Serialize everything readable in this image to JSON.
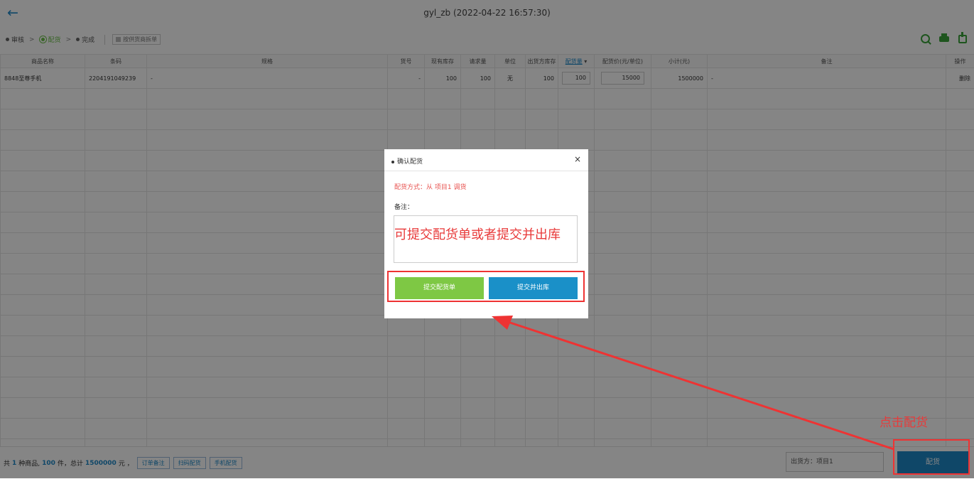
{
  "header": {
    "back_icon": "back-arrow-icon",
    "title": "gyl_zb  (2022-04-22 16:57:30)"
  },
  "steps": [
    {
      "label": "审核",
      "active": false
    },
    {
      "label": "配货",
      "active": true
    },
    {
      "label": "完成",
      "active": false
    }
  ],
  "split_by_supplier_label": "按供货商拆单",
  "tool_icons": [
    "search-icon",
    "print-icon",
    "export-icon"
  ],
  "table": {
    "columns": [
      "商品名称",
      "条码",
      "规格",
      "货号",
      "现有库存",
      "请求量",
      "单位",
      "出货方库存",
      "配货量",
      "配货价(元/单位)",
      "小计(元)",
      "备注",
      "操作"
    ],
    "rows": [
      {
        "name": "8848至尊手机",
        "barcode": "2204191049239",
        "spec": "-",
        "item_no": "-",
        "stock": "100",
        "requested": "100",
        "unit": "无",
        "supplier_stock": "100",
        "qty": "100",
        "price": "15000",
        "subtotal": "1500000",
        "remark": "-",
        "action": "删除"
      }
    ]
  },
  "footer": {
    "summary_prefix": "共",
    "kinds": "1",
    "kinds_unit": "种商品,",
    "pieces": "100",
    "pieces_unit": "件，总计",
    "total": "1500000",
    "total_unit": "元 ，",
    "buttons": [
      "订单备注",
      "扫码配货",
      "手机配货"
    ],
    "ship_from": "出货方：项目1",
    "distribute_button": "配货"
  },
  "modal": {
    "title": "确认配货",
    "close_icon": "close-icon",
    "method": "配货方式：从 项目1 调货",
    "remark_label": "备注：",
    "remark_value": "可提交配货单或者提交并出库",
    "submit_order": "提交配货单",
    "submit_and_out": "提交并出库"
  },
  "annotation": {
    "click_text": "点击配货",
    "colors": {
      "highlight": "#e33333"
    }
  }
}
